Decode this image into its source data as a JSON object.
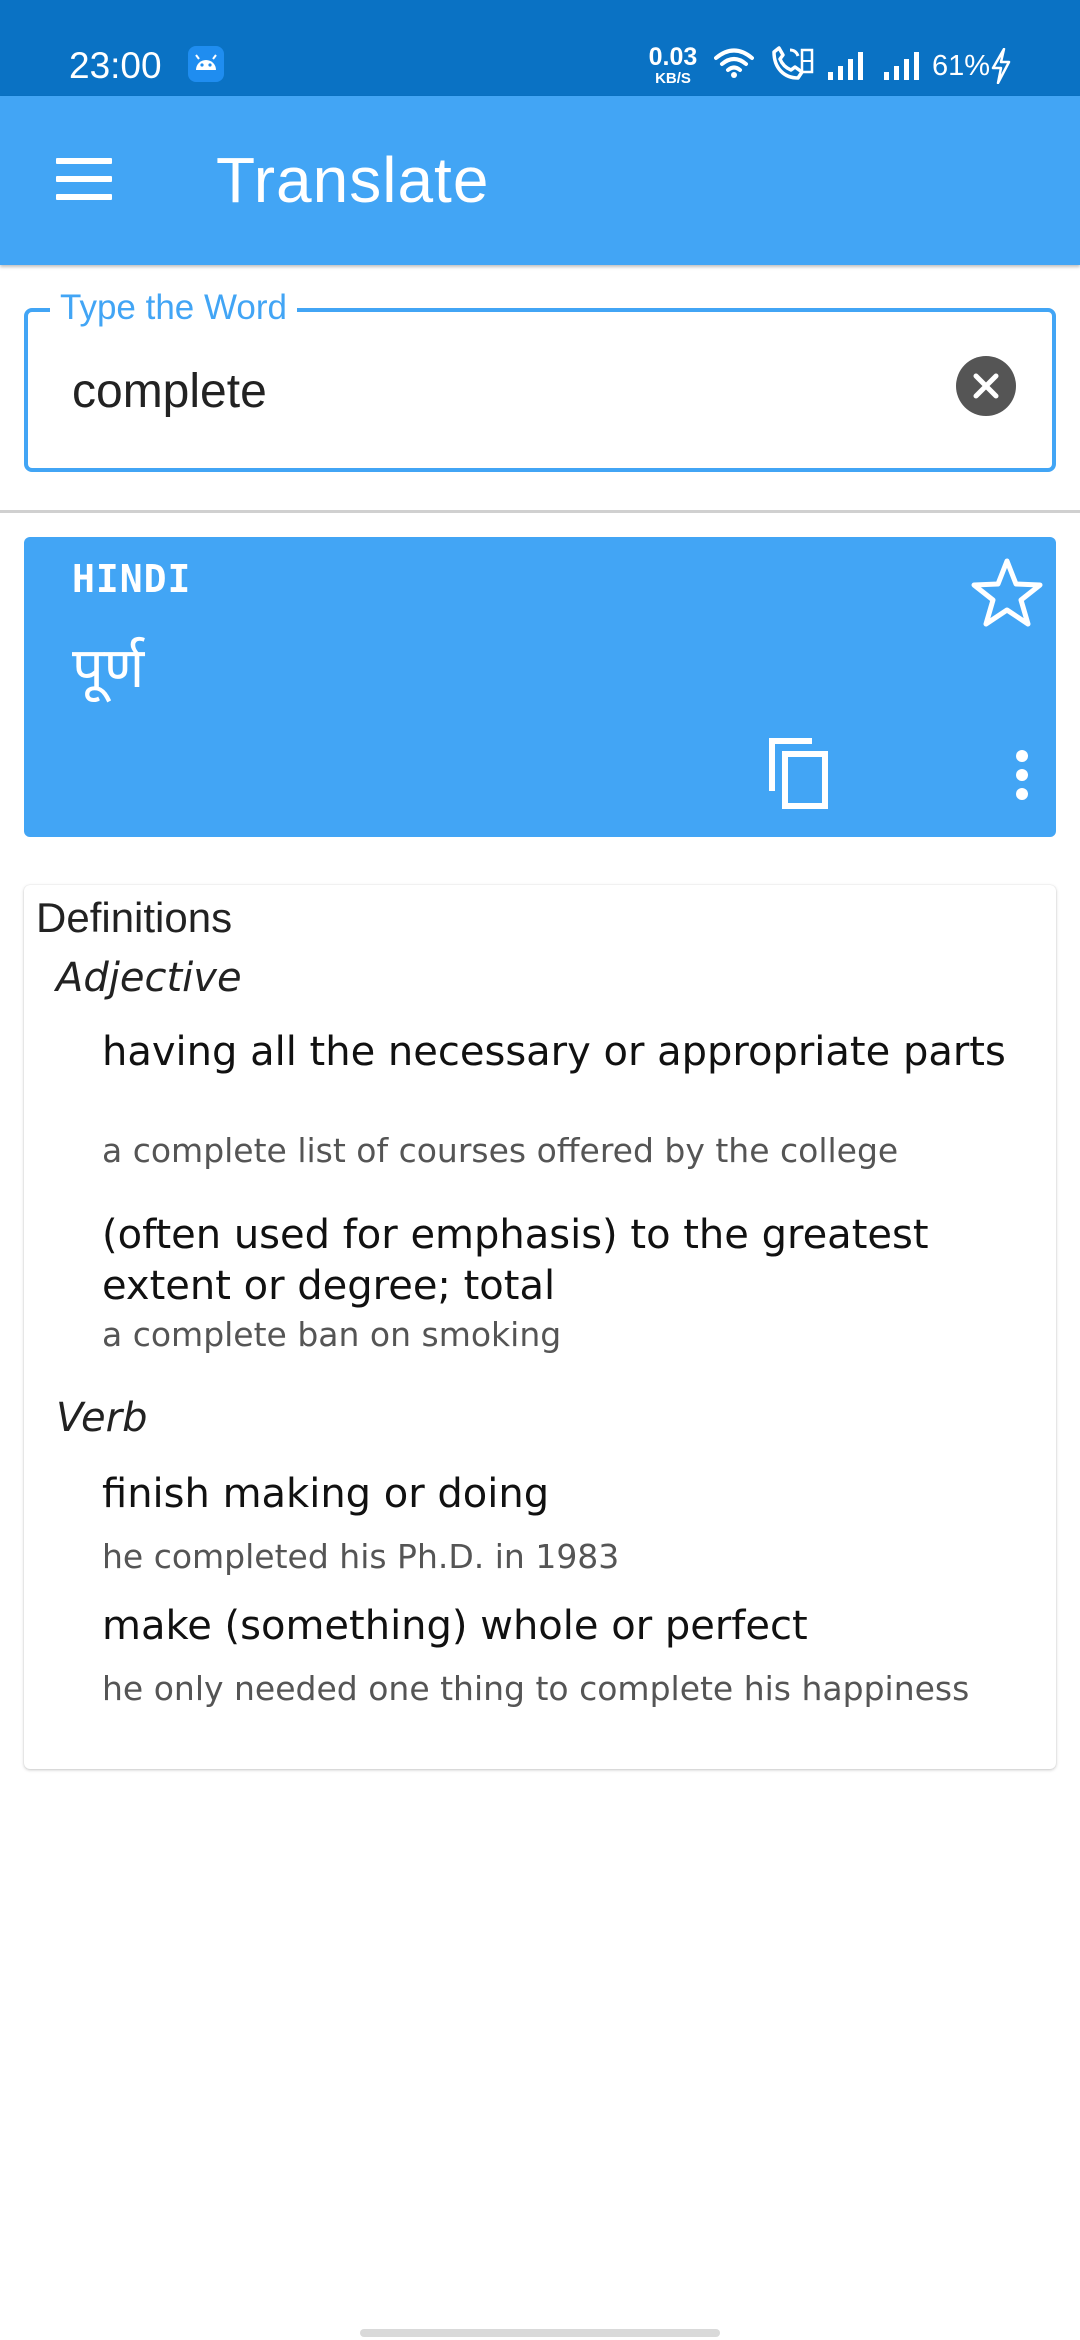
{
  "status_bar": {
    "time": "23:00",
    "net_speed": "0.03",
    "net_speed_unit": "KB/S",
    "battery": "61%",
    "icons": [
      "app-notification-icon",
      "wifi-icon",
      "volte-call-icon",
      "signal-icon",
      "signal-icon",
      "charging-icon"
    ]
  },
  "app_bar": {
    "title": "Translate",
    "menu_icon": "hamburger-menu-icon"
  },
  "search": {
    "label": "Type the Word",
    "value": "complete",
    "clear_icon": "clear-circle-icon"
  },
  "translation": {
    "language": "HINDI",
    "text": "पूर्ण",
    "icons": [
      "star-outline-icon",
      "copy-icon",
      "more-vert-icon"
    ]
  },
  "definitions": {
    "heading": "Definitions",
    "groups": [
      {
        "pos": "Adjective",
        "senses": [
          {
            "definition": "having all the necessary or appropriate parts",
            "example": "a complete list of courses offered by the college"
          },
          {
            "definition": "(often used for emphasis) to the greatest extent or degree; total",
            "example": "a complete ban on smoking"
          }
        ]
      },
      {
        "pos": "Verb",
        "senses": [
          {
            "definition": "finish making or doing",
            "example": "he completed his Ph.D. in 1983"
          },
          {
            "definition": "make (something) whole or perfect",
            "example": "he only needed one thing to complete his happiness"
          }
        ]
      }
    ]
  },
  "colors": {
    "status_bar": "#0a72c4",
    "primary": "#42a5f5",
    "text": "#222222",
    "secondary_text": "#555555"
  }
}
